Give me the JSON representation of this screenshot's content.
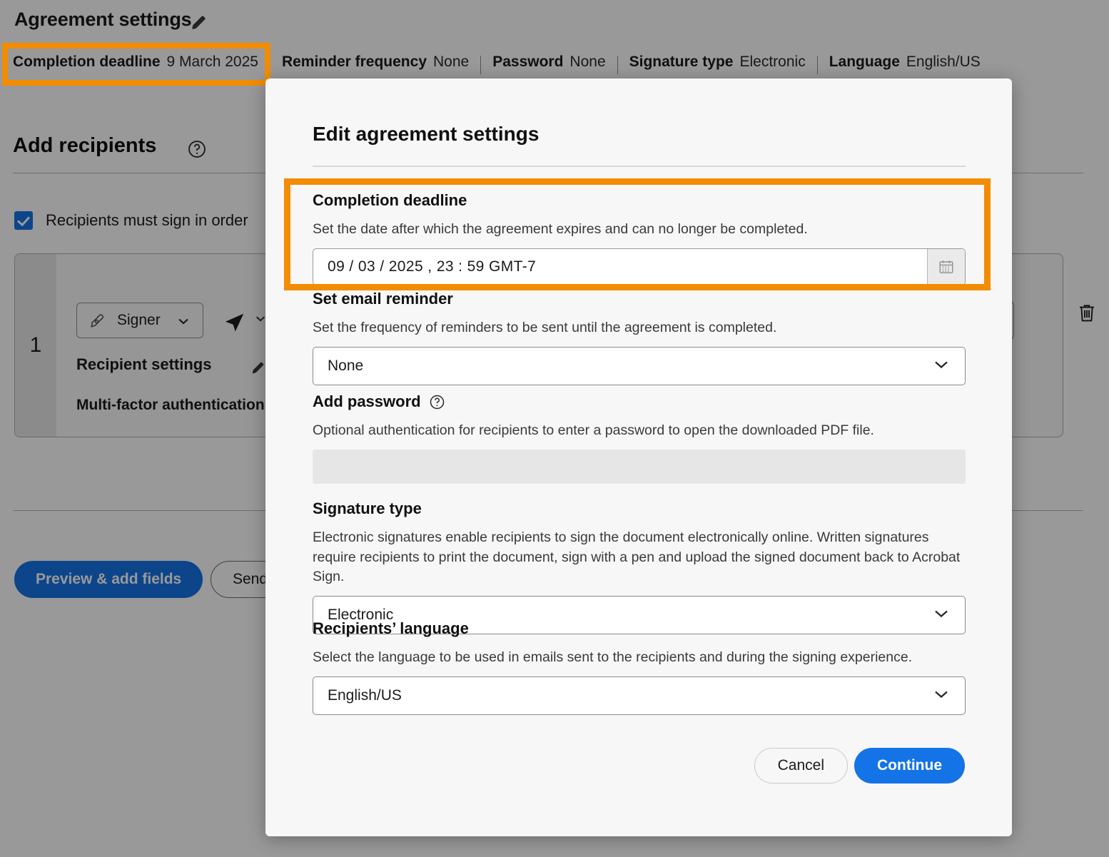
{
  "background": {
    "title": "Agreement settings",
    "title_edit_icon": "pencil-icon",
    "summary": [
      {
        "key": "Completion deadline",
        "value": "9 March 2025"
      },
      {
        "key": "Reminder frequency",
        "value": "None"
      },
      {
        "key": "Password",
        "value": "None"
      },
      {
        "key": "Signature type",
        "value": "Electronic"
      },
      {
        "key": "Language",
        "value": "English/US"
      }
    ],
    "add_recipients_heading": "Add recipients",
    "help_icon": "question-circle-icon",
    "sign_in_order_label": "Recipients must sign in order",
    "recipient": {
      "index": "1",
      "role": "Signer",
      "role_icon": "pen-nib-icon",
      "delivery_icon": "paper-plane-icon",
      "settings_label": "Recipient settings",
      "settings_edit_icon": "pencil-icon",
      "mfa_label": "Multi-factor authentication",
      "delete_icon": "trash-icon"
    },
    "buttons": {
      "preview": "Preview & add fields",
      "send": "Send"
    }
  },
  "dialog": {
    "title": "Edit agreement settings",
    "sections": {
      "deadline": {
        "label": "Completion deadline",
        "description": "Set the date after which the agreement expires and can no longer be completed.",
        "value": "09 /  03 / 2025 ,  23 : 59  GMT-7",
        "calendar_icon": "calendar-icon"
      },
      "reminder": {
        "label": "Set email reminder",
        "description": "Set the frequency of reminders to be sent until the agreement is completed.",
        "value": "None"
      },
      "password": {
        "label": "Add password",
        "help_icon": "question-circle-icon",
        "description": "Optional authentication for recipients to enter a password to open the downloaded PDF file.",
        "value": ""
      },
      "signature": {
        "label": "Signature type",
        "description": "Electronic signatures enable recipients to sign the document electronically online. Written signatures require recipients to print the document, sign with a pen and upload the signed document back to Acrobat Sign.",
        "value": "Electronic"
      },
      "language": {
        "label": "Recipients’ language",
        "description": "Select the language to be used in emails sent to the recipients and during the signing experience.",
        "value": "English/US"
      }
    },
    "buttons": {
      "cancel": "Cancel",
      "continue": "Continue"
    }
  },
  "annotations": {
    "highlight_color": "#F28C00",
    "accent_color": "#1473E6"
  }
}
